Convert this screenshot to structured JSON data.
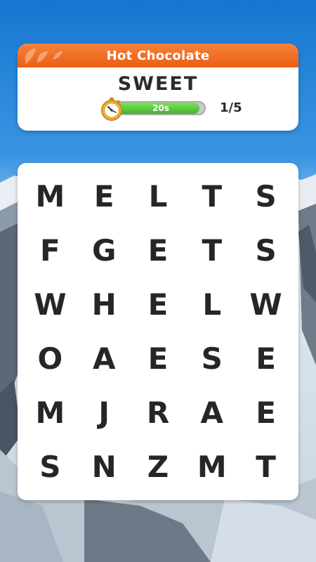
{
  "header": {
    "category_title": "Hot Chocolate",
    "target_word": "SWEET",
    "timer": {
      "label": "20s",
      "fill_fraction": 0.94,
      "color": "#46bd31"
    },
    "progress": "1/5",
    "accent_color": "#ef6d22"
  },
  "board": {
    "rows": [
      [
        "M",
        "E",
        "L",
        "T",
        "S"
      ],
      [
        "F",
        "G",
        "E",
        "T",
        "S"
      ],
      [
        "W",
        "H",
        "E",
        "L",
        "W"
      ],
      [
        "O",
        "A",
        "E",
        "S",
        "E"
      ],
      [
        "M",
        "J",
        "R",
        "A",
        "E"
      ],
      [
        "S",
        "N",
        "Z",
        "M",
        "T"
      ]
    ]
  },
  "icons": {
    "timer": "stopwatch-icon",
    "header_decoration": "leaf-icon"
  }
}
